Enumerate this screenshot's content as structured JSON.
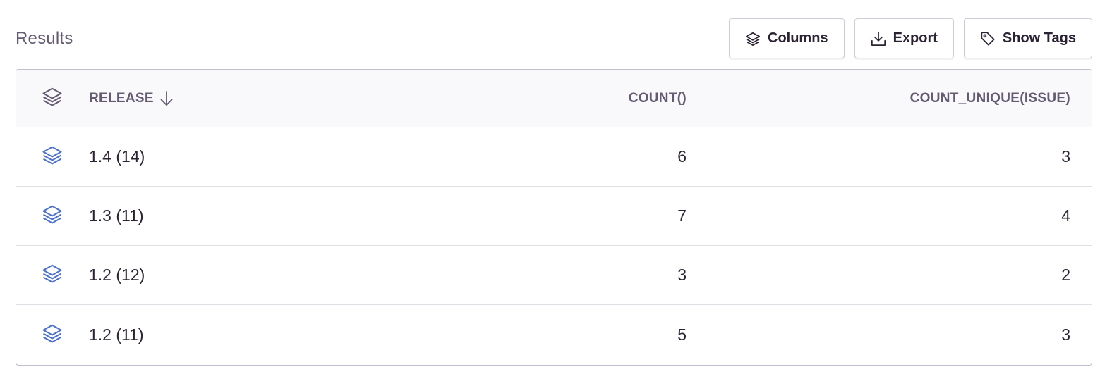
{
  "header": {
    "title": "Results",
    "buttons": {
      "columns": "Columns",
      "export": "Export",
      "show_tags": "Show Tags"
    }
  },
  "table": {
    "columns": {
      "release": "RELEASE",
      "count": "COUNT()",
      "count_unique": "COUNT_UNIQUE(ISSUE)"
    },
    "sort": "descending",
    "rows": [
      {
        "release": "1.4 (14)",
        "count": "6",
        "count_unique": "3"
      },
      {
        "release": "1.3 (11)",
        "count": "7",
        "count_unique": "4"
      },
      {
        "release": "1.2 (12)",
        "count": "3",
        "count_unique": "2"
      },
      {
        "release": "1.2 (11)",
        "count": "5",
        "count_unique": "3"
      }
    ]
  },
  "icons": {
    "columns": "stack-icon",
    "export": "download-icon",
    "show_tags": "tag-icon",
    "row": "stack-icon",
    "sort": "arrow-down-icon"
  },
  "colors": {
    "row_icon": "#4a6fd0",
    "header_icon": "#645a72",
    "header_text": "#645a72",
    "border": "#c6bece"
  }
}
